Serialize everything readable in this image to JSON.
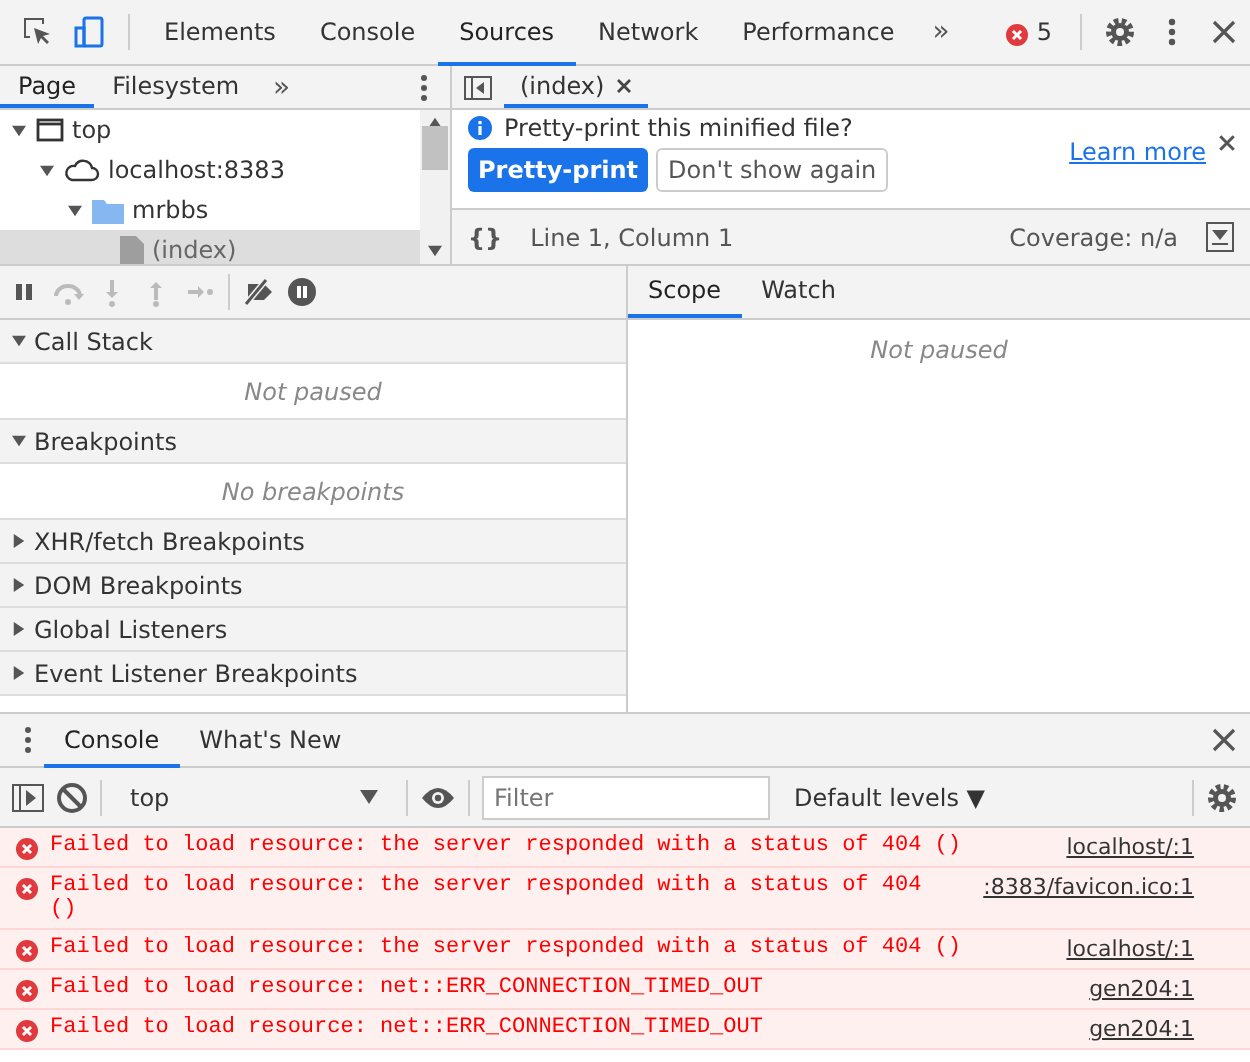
{
  "main_tabs": [
    {
      "label": "Elements",
      "selected": false
    },
    {
      "label": "Console",
      "selected": false
    },
    {
      "label": "Sources",
      "selected": true
    },
    {
      "label": "Network",
      "selected": false
    },
    {
      "label": "Performance",
      "selected": false
    }
  ],
  "more_tabs": "»",
  "error_count": "5",
  "navigator": {
    "tabs": [
      {
        "label": "Page",
        "selected": true
      },
      {
        "label": "Filesystem",
        "selected": false
      }
    ],
    "more": "»",
    "tree": [
      {
        "kind": "frame",
        "label": "top",
        "expanded": true,
        "selected": false,
        "children": [
          {
            "kind": "domain",
            "label": "localhost:8383",
            "expanded": true,
            "selected": false,
            "children": [
              {
                "kind": "folder",
                "label": "mrbbs",
                "expanded": true,
                "selected": false,
                "children": [
                  {
                    "kind": "file",
                    "label": "(index)",
                    "selected": true
                  }
                ]
              }
            ]
          }
        ]
      }
    ]
  },
  "editor": {
    "tabs": [
      {
        "label": "(index)",
        "selected": true
      }
    ],
    "infobar": {
      "message": "Pretty-print this minified file?",
      "link": "Learn more",
      "primary_button": "Pretty-print",
      "secondary_button": "Don't show again"
    },
    "status": {
      "format": "{}",
      "position": "Line 1, Column 1",
      "coverage": "Coverage: n/a"
    }
  },
  "debugger": {
    "toolbar": [
      {
        "kind": "pause",
        "disabled": false
      },
      {
        "kind": "step-over",
        "disabled": true
      },
      {
        "kind": "step-into",
        "disabled": true
      },
      {
        "kind": "step-out",
        "disabled": true
      },
      {
        "kind": "step",
        "disabled": true
      },
      {
        "kind": "deactivate",
        "disabled": false
      },
      {
        "kind": "pause-exceptions",
        "disabled": false
      }
    ],
    "sections": [
      {
        "label": "Call Stack",
        "expanded": true,
        "empty_text": "Not paused"
      },
      {
        "label": "Breakpoints",
        "expanded": true,
        "empty_text": "No breakpoints"
      },
      {
        "label": "XHR/fetch Breakpoints",
        "expanded": false
      },
      {
        "label": "DOM Breakpoints",
        "expanded": false
      },
      {
        "label": "Global Listeners",
        "expanded": false
      },
      {
        "label": "Event Listener Breakpoints",
        "expanded": false
      }
    ],
    "side_tabs": [
      {
        "label": "Scope",
        "selected": true
      },
      {
        "label": "Watch",
        "selected": false
      }
    ],
    "side_empty_text": "Not paused"
  },
  "drawer": {
    "tabs": [
      {
        "label": "Console",
        "selected": true
      },
      {
        "label": "What's New",
        "selected": false
      }
    ],
    "context": "top",
    "filter_placeholder": "Filter",
    "levels": "Default levels ▼",
    "messages": [
      {
        "text": "Failed to load resource: the server responded with a status of 404 ()",
        "source": "localhost/:1"
      },
      {
        "text": "Failed to load resource: the server responded with a status of 404 ()",
        "source": ":8383/favicon.ico:1"
      },
      {
        "text": "Failed to load resource: the server responded with a status of 404 ()",
        "source": "localhost/:1"
      },
      {
        "text": "Failed to load resource: net::ERR_CONNECTION_TIMED_OUT",
        "source": "gen204:1"
      },
      {
        "text": "Failed to load resource: net::ERR_CONNECTION_TIMED_OUT",
        "source": "gen204:1"
      }
    ]
  }
}
